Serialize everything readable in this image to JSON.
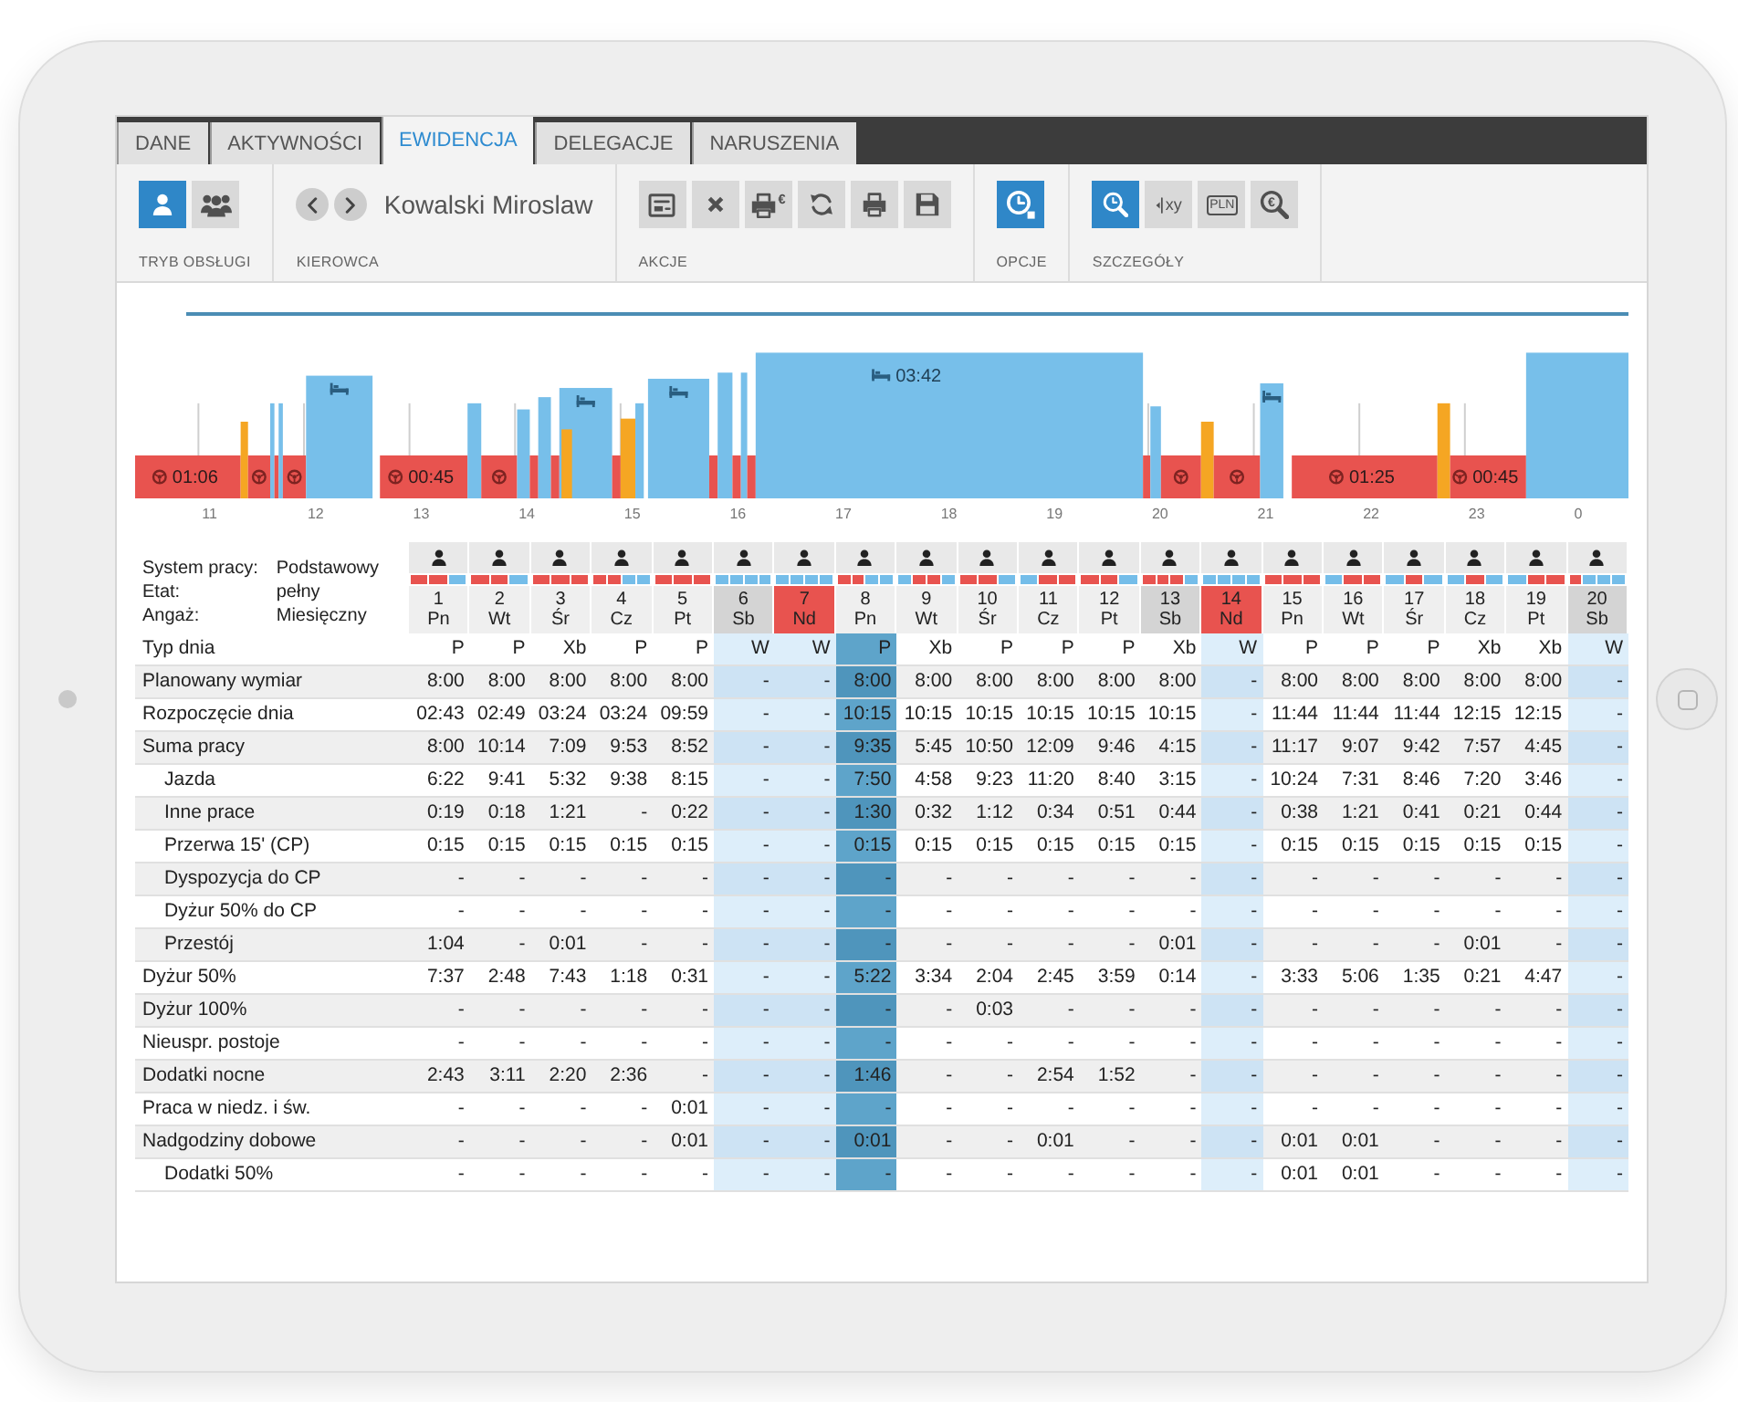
{
  "tabs": [
    {
      "label": "DANE",
      "selected": false
    },
    {
      "label": "AKTYWNOŚCI",
      "selected": false
    },
    {
      "label": "EWIDENCJA",
      "selected": true
    },
    {
      "label": "DELEGACJE",
      "selected": false
    },
    {
      "label": "NARUSZENIA",
      "selected": false
    }
  ],
  "ribbon": {
    "groups": [
      {
        "kind": "buttons",
        "label": "TRYB OBSŁUGI",
        "buttons": [
          {
            "kind": "person",
            "selected": true
          },
          {
            "kind": "people",
            "selected": false
          }
        ]
      },
      {
        "kind": "driver",
        "label": "KIEROWCA",
        "name": "Kowalski Miroslaw"
      },
      {
        "kind": "buttons",
        "label": "AKCJE",
        "buttons": [
          {
            "kind": "form"
          },
          {
            "kind": "close"
          },
          {
            "kind": "print-cost",
            "text": "€"
          },
          {
            "kind": "refresh"
          },
          {
            "kind": "print"
          },
          {
            "kind": "save"
          }
        ]
      },
      {
        "kind": "buttons",
        "label": "OPCJE",
        "buttons": [
          {
            "kind": "clock",
            "selected": true
          }
        ]
      },
      {
        "kind": "buttons",
        "label": "SZCZEGÓŁY",
        "buttons": [
          {
            "kind": "search-clock",
            "selected": true
          },
          {
            "kind": "xy",
            "text": "xy",
            "selected": false
          },
          {
            "kind": "banknote",
            "text": "PLN",
            "selected": false
          },
          {
            "kind": "search-currency",
            "text": "€",
            "selected": false
          }
        ]
      }
    ]
  },
  "timeline": {
    "hours": [
      "11",
      "12",
      "13",
      "14",
      "15",
      "16",
      "17",
      "18",
      "19",
      "20",
      "21",
      "22",
      "23",
      "0"
    ],
    "blocks": [
      {
        "kind": "drive",
        "label": "01:06"
      },
      {
        "kind": "work"
      },
      {
        "kind": "drive"
      },
      {
        "kind": "rest"
      },
      {
        "kind": "drive"
      },
      {
        "kind": "rest"
      },
      {
        "kind": "drive"
      },
      {
        "kind": "rest"
      },
      {
        "kind": "drive",
        "label": "00:45"
      },
      {
        "kind": "rest"
      },
      {
        "kind": "drive"
      },
      {
        "kind": "rest"
      },
      {
        "kind": "drive"
      },
      {
        "kind": "rest"
      },
      {
        "kind": "drive"
      },
      {
        "kind": "rest"
      },
      {
        "kind": "work"
      },
      {
        "kind": "drive"
      },
      {
        "kind": "work"
      },
      {
        "kind": "rest"
      },
      {
        "kind": "rest"
      },
      {
        "kind": "drive"
      },
      {
        "kind": "rest"
      },
      {
        "kind": "drive"
      },
      {
        "kind": "rest"
      },
      {
        "kind": "drive"
      },
      {
        "kind": "rest",
        "label": "03:42"
      },
      {
        "kind": "drive"
      },
      {
        "kind": "rest"
      },
      {
        "kind": "drive"
      },
      {
        "kind": "work"
      },
      {
        "kind": "drive"
      },
      {
        "kind": "rest"
      },
      {
        "kind": "drive",
        "label": "01:25"
      },
      {
        "kind": "work"
      },
      {
        "kind": "drive",
        "label": "00:45"
      },
      {
        "kind": "rest"
      }
    ]
  },
  "info": [
    {
      "label": "System pracy:",
      "value": "Podstawowy"
    },
    {
      "label": "Etat:",
      "value": "pełny"
    },
    {
      "label": "Angaż:",
      "value": "Miesięczny"
    }
  ],
  "days": [
    {
      "number": "1",
      "weekday": "Pn",
      "kind": "weekday",
      "off": false,
      "selected": false,
      "strip": [
        {
          "kind": "drive"
        },
        {
          "kind": "drive"
        },
        {
          "kind": "rest"
        }
      ]
    },
    {
      "number": "2",
      "weekday": "Wt",
      "kind": "weekday",
      "off": false,
      "selected": false,
      "strip": [
        {
          "kind": "drive"
        },
        {
          "kind": "drive"
        },
        {
          "kind": "rest"
        }
      ]
    },
    {
      "number": "3",
      "weekday": "Śr",
      "kind": "weekday",
      "off": false,
      "selected": false,
      "strip": [
        {
          "kind": "drive"
        },
        {
          "kind": "drive"
        },
        {
          "kind": "drive"
        }
      ]
    },
    {
      "number": "4",
      "weekday": "Cz",
      "kind": "weekday",
      "off": false,
      "selected": false,
      "strip": [
        {
          "kind": "drive"
        },
        {
          "kind": "drive"
        },
        {
          "kind": "rest"
        },
        {
          "kind": "rest"
        }
      ]
    },
    {
      "number": "5",
      "weekday": "Pt",
      "kind": "weekday",
      "off": false,
      "selected": false,
      "strip": [
        {
          "kind": "drive"
        },
        {
          "kind": "drive"
        },
        {
          "kind": "drive"
        }
      ]
    },
    {
      "number": "6",
      "weekday": "Sb",
      "kind": "saturday",
      "off": true,
      "selected": false,
      "strip": [
        {
          "kind": "rest"
        },
        {
          "kind": "rest"
        },
        {
          "kind": "rest"
        },
        {
          "kind": "rest"
        }
      ]
    },
    {
      "number": "7",
      "weekday": "Nd",
      "kind": "sunday",
      "off": true,
      "selected": false,
      "strip": [
        {
          "kind": "rest"
        },
        {
          "kind": "rest"
        },
        {
          "kind": "rest"
        },
        {
          "kind": "rest"
        }
      ]
    },
    {
      "number": "8",
      "weekday": "Pn",
      "kind": "weekday",
      "off": false,
      "selected": true,
      "strip": [
        {
          "kind": "drive"
        },
        {
          "kind": "drive"
        },
        {
          "kind": "rest"
        },
        {
          "kind": "rest"
        }
      ]
    },
    {
      "number": "9",
      "weekday": "Wt",
      "kind": "weekday",
      "off": false,
      "selected": false,
      "strip": [
        {
          "kind": "rest"
        },
        {
          "kind": "drive"
        },
        {
          "kind": "drive"
        },
        {
          "kind": "rest"
        }
      ]
    },
    {
      "number": "10",
      "weekday": "Śr",
      "kind": "weekday",
      "off": false,
      "selected": false,
      "strip": [
        {
          "kind": "drive"
        },
        {
          "kind": "drive"
        },
        {
          "kind": "rest"
        }
      ]
    },
    {
      "number": "11",
      "weekday": "Cz",
      "kind": "weekday",
      "off": false,
      "selected": false,
      "strip": [
        {
          "kind": "rest"
        },
        {
          "kind": "drive"
        },
        {
          "kind": "drive"
        }
      ]
    },
    {
      "number": "12",
      "weekday": "Pt",
      "kind": "weekday",
      "off": false,
      "selected": false,
      "strip": [
        {
          "kind": "drive"
        },
        {
          "kind": "drive"
        },
        {
          "kind": "rest"
        }
      ]
    },
    {
      "number": "13",
      "weekday": "Sb",
      "kind": "saturday",
      "off": false,
      "selected": false,
      "strip": [
        {
          "kind": "drive"
        },
        {
          "kind": "drive"
        },
        {
          "kind": "drive"
        },
        {
          "kind": "rest"
        }
      ]
    },
    {
      "number": "14",
      "weekday": "Nd",
      "kind": "sunday",
      "off": true,
      "selected": false,
      "strip": [
        {
          "kind": "rest"
        },
        {
          "kind": "rest"
        },
        {
          "kind": "rest"
        },
        {
          "kind": "rest"
        }
      ]
    },
    {
      "number": "15",
      "weekday": "Pn",
      "kind": "weekday",
      "off": false,
      "selected": false,
      "strip": [
        {
          "kind": "drive"
        },
        {
          "kind": "drive"
        },
        {
          "kind": "drive"
        }
      ]
    },
    {
      "number": "16",
      "weekday": "Wt",
      "kind": "weekday",
      "off": false,
      "selected": false,
      "strip": [
        {
          "kind": "rest"
        },
        {
          "kind": "drive"
        },
        {
          "kind": "drive"
        }
      ]
    },
    {
      "number": "17",
      "weekday": "Śr",
      "kind": "weekday",
      "off": false,
      "selected": false,
      "strip": [
        {
          "kind": "rest"
        },
        {
          "kind": "drive"
        },
        {
          "kind": "rest"
        }
      ]
    },
    {
      "number": "18",
      "weekday": "Cz",
      "kind": "weekday",
      "off": false,
      "selected": false,
      "strip": [
        {
          "kind": "rest"
        },
        {
          "kind": "drive"
        },
        {
          "kind": "rest"
        }
      ]
    },
    {
      "number": "19",
      "weekday": "Pt",
      "kind": "weekday",
      "off": false,
      "selected": false,
      "strip": [
        {
          "kind": "rest"
        },
        {
          "kind": "drive"
        },
        {
          "kind": "drive"
        }
      ]
    },
    {
      "number": "20",
      "weekday": "Sb",
      "kind": "saturday",
      "off": true,
      "selected": false,
      "strip": [
        {
          "kind": "drive"
        },
        {
          "kind": "rest"
        },
        {
          "kind": "rest"
        },
        {
          "kind": "rest"
        }
      ]
    }
  ],
  "rows": [
    {
      "label": "Typ dnia",
      "values": [
        "P",
        "P",
        "Xb",
        "P",
        "P",
        "W",
        "W",
        "P",
        "Xb",
        "P",
        "P",
        "P",
        "Xb",
        "W",
        "P",
        "P",
        "P",
        "Xb",
        "Xb",
        "W"
      ]
    },
    {
      "label": "Planowany wymiar",
      "values": [
        "8:00",
        "8:00",
        "8:00",
        "8:00",
        "8:00",
        "-",
        "-",
        "8:00",
        "8:00",
        "8:00",
        "8:00",
        "8:00",
        "8:00",
        "-",
        "8:00",
        "8:00",
        "8:00",
        "8:00",
        "8:00",
        "-"
      ]
    },
    {
      "label": "Rozpoczęcie dnia",
      "values": [
        "02:43",
        "02:49",
        "03:24",
        "03:24",
        "09:59",
        "-",
        "-",
        "10:15",
        "10:15",
        "10:15",
        "10:15",
        "10:15",
        "10:15",
        "-",
        "11:44",
        "11:44",
        "11:44",
        "12:15",
        "12:15",
        "-"
      ]
    },
    {
      "label": "Suma pracy",
      "values": [
        "8:00",
        "10:14",
        "7:09",
        "9:53",
        "8:52",
        "-",
        "-",
        "9:35",
        "5:45",
        "10:50",
        "12:09",
        "9:46",
        "4:15",
        "-",
        "11:17",
        "9:07",
        "9:42",
        "7:57",
        "4:45",
        "-"
      ],
      "children": [
        {
          "label": "Jazda",
          "values": [
            "6:22",
            "9:41",
            "5:32",
            "9:38",
            "8:15",
            "-",
            "-",
            "7:50",
            "4:58",
            "9:23",
            "11:20",
            "8:40",
            "3:15",
            "-",
            "10:24",
            "7:31",
            "8:46",
            "7:20",
            "3:46",
            "-"
          ]
        },
        {
          "label": "Inne prace",
          "values": [
            "0:19",
            "0:18",
            "1:21",
            "-",
            "0:22",
            "-",
            "-",
            "1:30",
            "0:32",
            "1:12",
            "0:34",
            "0:51",
            "0:44",
            "-",
            "0:38",
            "1:21",
            "0:41",
            "0:21",
            "0:44",
            "-"
          ]
        },
        {
          "label": "Przerwa 15' (CP)",
          "values": [
            "0:15",
            "0:15",
            "0:15",
            "0:15",
            "0:15",
            "-",
            "-",
            "0:15",
            "0:15",
            "0:15",
            "0:15",
            "0:15",
            "0:15",
            "-",
            "0:15",
            "0:15",
            "0:15",
            "0:15",
            "0:15",
            "-"
          ]
        },
        {
          "label": "Dyspozycja do CP",
          "values": [
            "-",
            "-",
            "-",
            "-",
            "-",
            "-",
            "-",
            "-",
            "-",
            "-",
            "-",
            "-",
            "-",
            "-",
            "-",
            "-",
            "-",
            "-",
            "-",
            "-"
          ]
        },
        {
          "label": "Dyżur 50% do CP",
          "values": [
            "-",
            "-",
            "-",
            "-",
            "-",
            "-",
            "-",
            "-",
            "-",
            "-",
            "-",
            "-",
            "-",
            "-",
            "-",
            "-",
            "-",
            "-",
            "-",
            "-"
          ]
        },
        {
          "label": "Przestój",
          "values": [
            "1:04",
            "-",
            "0:01",
            "-",
            "-",
            "-",
            "-",
            "-",
            "-",
            "-",
            "-",
            "-",
            "0:01",
            "-",
            "-",
            "-",
            "-",
            "0:01",
            "-",
            "-"
          ]
        }
      ]
    },
    {
      "label": "Dyżur 50%",
      "values": [
        "7:37",
        "2:48",
        "7:43",
        "1:18",
        "0:31",
        "-",
        "-",
        "5:22",
        "3:34",
        "2:04",
        "2:45",
        "3:59",
        "0:14",
        "-",
        "3:33",
        "5:06",
        "1:35",
        "0:21",
        "4:47",
        "-"
      ]
    },
    {
      "label": "Dyżur 100%",
      "values": [
        "-",
        "-",
        "-",
        "-",
        "-",
        "-",
        "-",
        "-",
        "-",
        "0:03",
        "-",
        "-",
        "-",
        "-",
        "-",
        "-",
        "-",
        "-",
        "-",
        "-"
      ]
    },
    {
      "label": "Nieuspr. postoje",
      "values": [
        "-",
        "-",
        "-",
        "-",
        "-",
        "-",
        "-",
        "-",
        "-",
        "-",
        "-",
        "-",
        "-",
        "-",
        "-",
        "-",
        "-",
        "-",
        "-",
        "-"
      ]
    },
    {
      "label": "Dodatki nocne",
      "values": [
        "2:43",
        "3:11",
        "2:20",
        "2:36",
        "-",
        "-",
        "-",
        "1:46",
        "-",
        "-",
        "2:54",
        "1:52",
        "-",
        "-",
        "-",
        "-",
        "-",
        "-",
        "-",
        "-"
      ]
    },
    {
      "label": "Praca w niedz. i św.",
      "values": [
        "-",
        "-",
        "-",
        "-",
        "0:01",
        "-",
        "-",
        "-",
        "-",
        "-",
        "-",
        "-",
        "-",
        "-",
        "-",
        "-",
        "-",
        "-",
        "-",
        "-"
      ]
    },
    {
      "label": "Nadgodziny dobowe",
      "values": [
        "-",
        "-",
        "-",
        "-",
        "0:01",
        "-",
        "-",
        "0:01",
        "-",
        "-",
        "0:01",
        "-",
        "-",
        "-",
        "0:01",
        "0:01",
        "-",
        "-",
        "-",
        "-"
      ],
      "children": [
        {
          "label": "Dodatki 50%",
          "values": [
            "-",
            "-",
            "-",
            "-",
            "-",
            "-",
            "-",
            "-",
            "-",
            "-",
            "-",
            "-",
            "-",
            "-",
            "0:01",
            "0:01",
            "-",
            "-",
            "-",
            "-"
          ]
        }
      ]
    }
  ]
}
